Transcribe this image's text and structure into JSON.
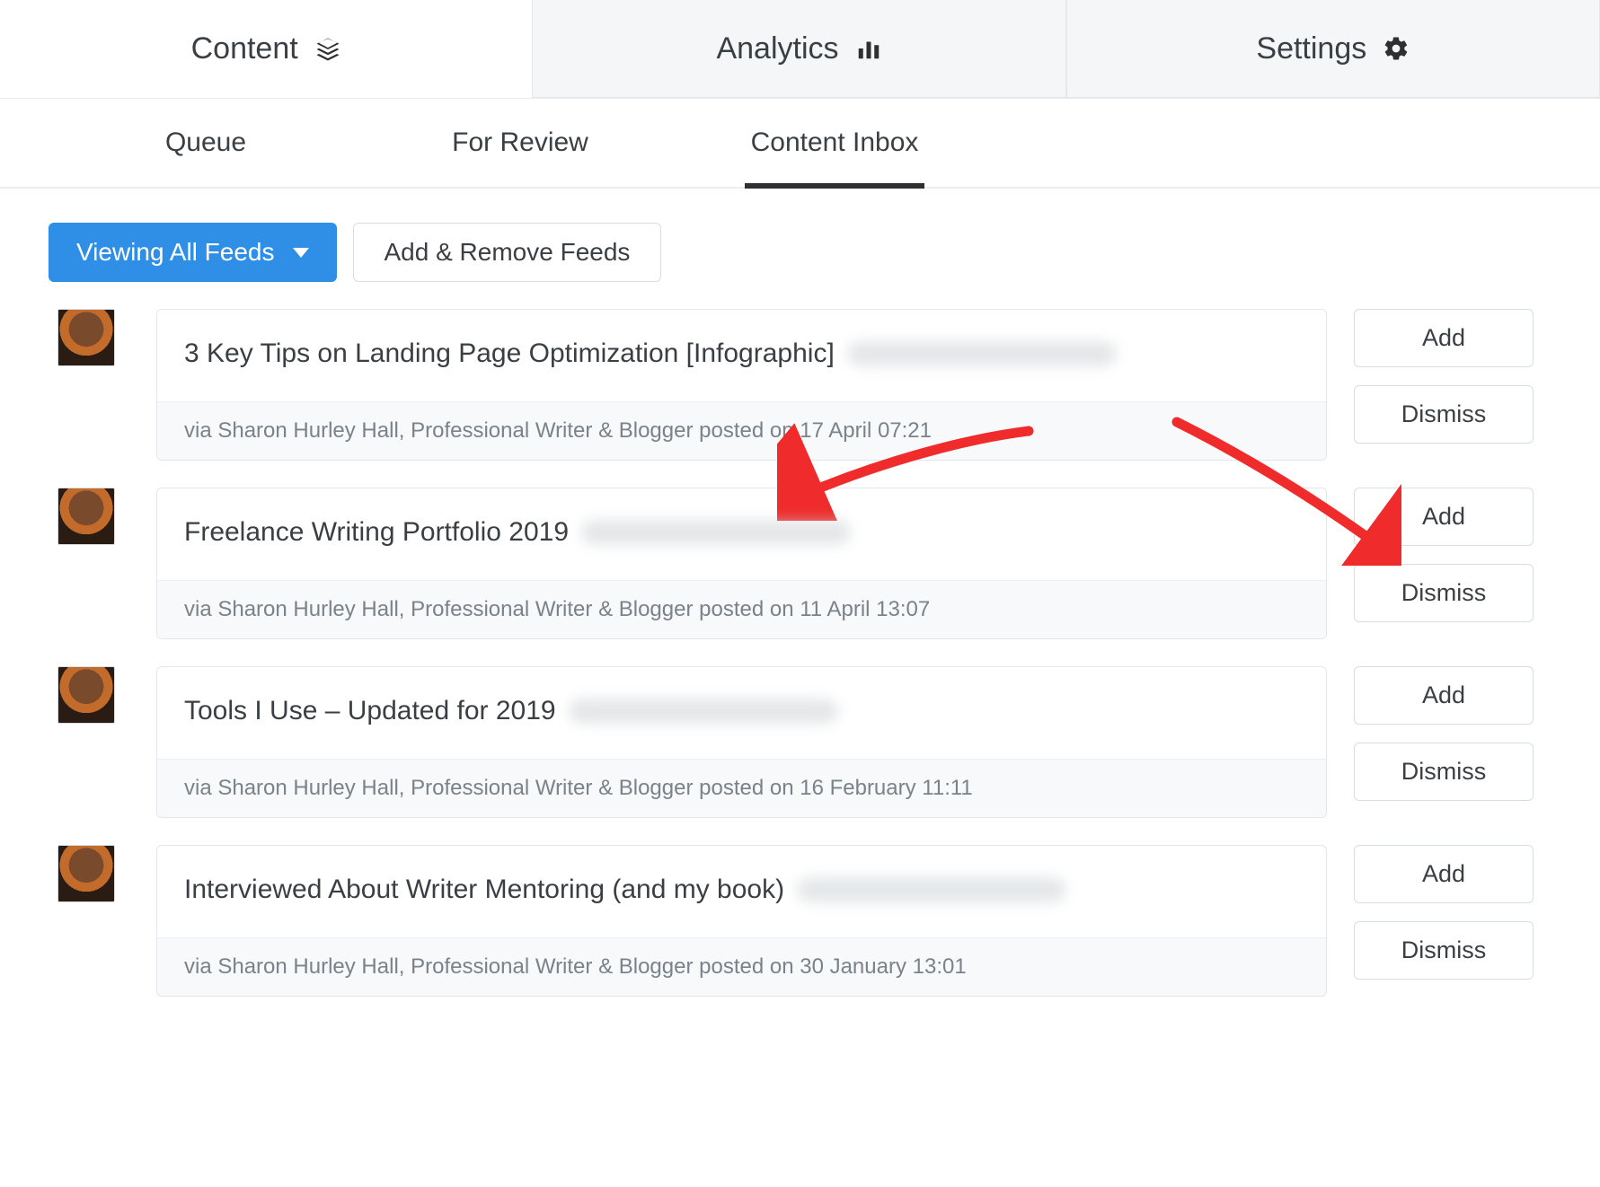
{
  "topnav": {
    "content": "Content",
    "analytics": "Analytics",
    "settings": "Settings"
  },
  "subnav": {
    "queue": "Queue",
    "for_review": "For Review",
    "content_inbox": "Content Inbox"
  },
  "toolbar": {
    "viewing_label": "Viewing All Feeds",
    "add_remove_label": "Add & Remove Feeds"
  },
  "buttons": {
    "add": "Add",
    "dismiss": "Dismiss"
  },
  "feeds": [
    {
      "title": "3 Key Tips on Landing Page Optimization [Infographic]",
      "meta": "via Sharon Hurley Hall, Professional Writer & Blogger posted on 17 April 07:21"
    },
    {
      "title": "Freelance Writing Portfolio 2019",
      "meta": "via Sharon Hurley Hall, Professional Writer & Blogger posted on 11 April 13:07"
    },
    {
      "title": "Tools I Use – Updated for 2019",
      "meta": "via Sharon Hurley Hall, Professional Writer & Blogger posted on 16 February 11:11"
    },
    {
      "title": "Interviewed About Writer Mentoring (and my book)",
      "meta": "via Sharon Hurley Hall, Professional Writer & Blogger posted on 30 January 13:01"
    }
  ]
}
